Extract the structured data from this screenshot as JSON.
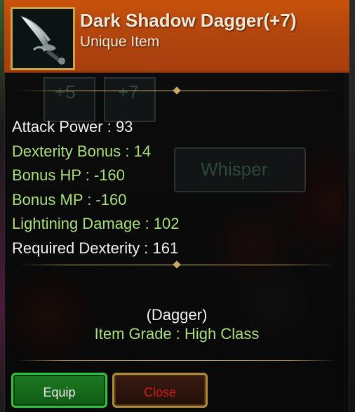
{
  "item": {
    "name": "Dark Shadow Dagger(+7)",
    "rarity": "Unique Item",
    "icon": "dagger-icon"
  },
  "stats": [
    {
      "text": "Attack Power : 93",
      "color": "#f1f1f1"
    },
    {
      "text": "Dexterity Bonus : 14",
      "color": "#a9e07a"
    },
    {
      "text": "Bonus HP : -160",
      "color": "#a9e07a"
    },
    {
      "text": "Bonus MP : -160",
      "color": "#a9e07a"
    },
    {
      "text": "Lightining Damage : 102",
      "color": "#a9e07a"
    },
    {
      "text": "Required Dexterity : 161",
      "color": "#f1f1f1"
    }
  ],
  "info": {
    "type": "(Dagger)",
    "grade": "Item Grade : High Class"
  },
  "buttons": {
    "equip": "Equip",
    "close": "Close"
  },
  "background": {
    "whisper_button": "Whisper",
    "slot_labels": [
      "+5",
      "+7"
    ]
  },
  "colors": {
    "header": "#b3460d",
    "stat_white": "#f1f1f1",
    "stat_green": "#a9e07a",
    "equip_border": "#2cc43a",
    "close_text": "#d11a1a"
  }
}
